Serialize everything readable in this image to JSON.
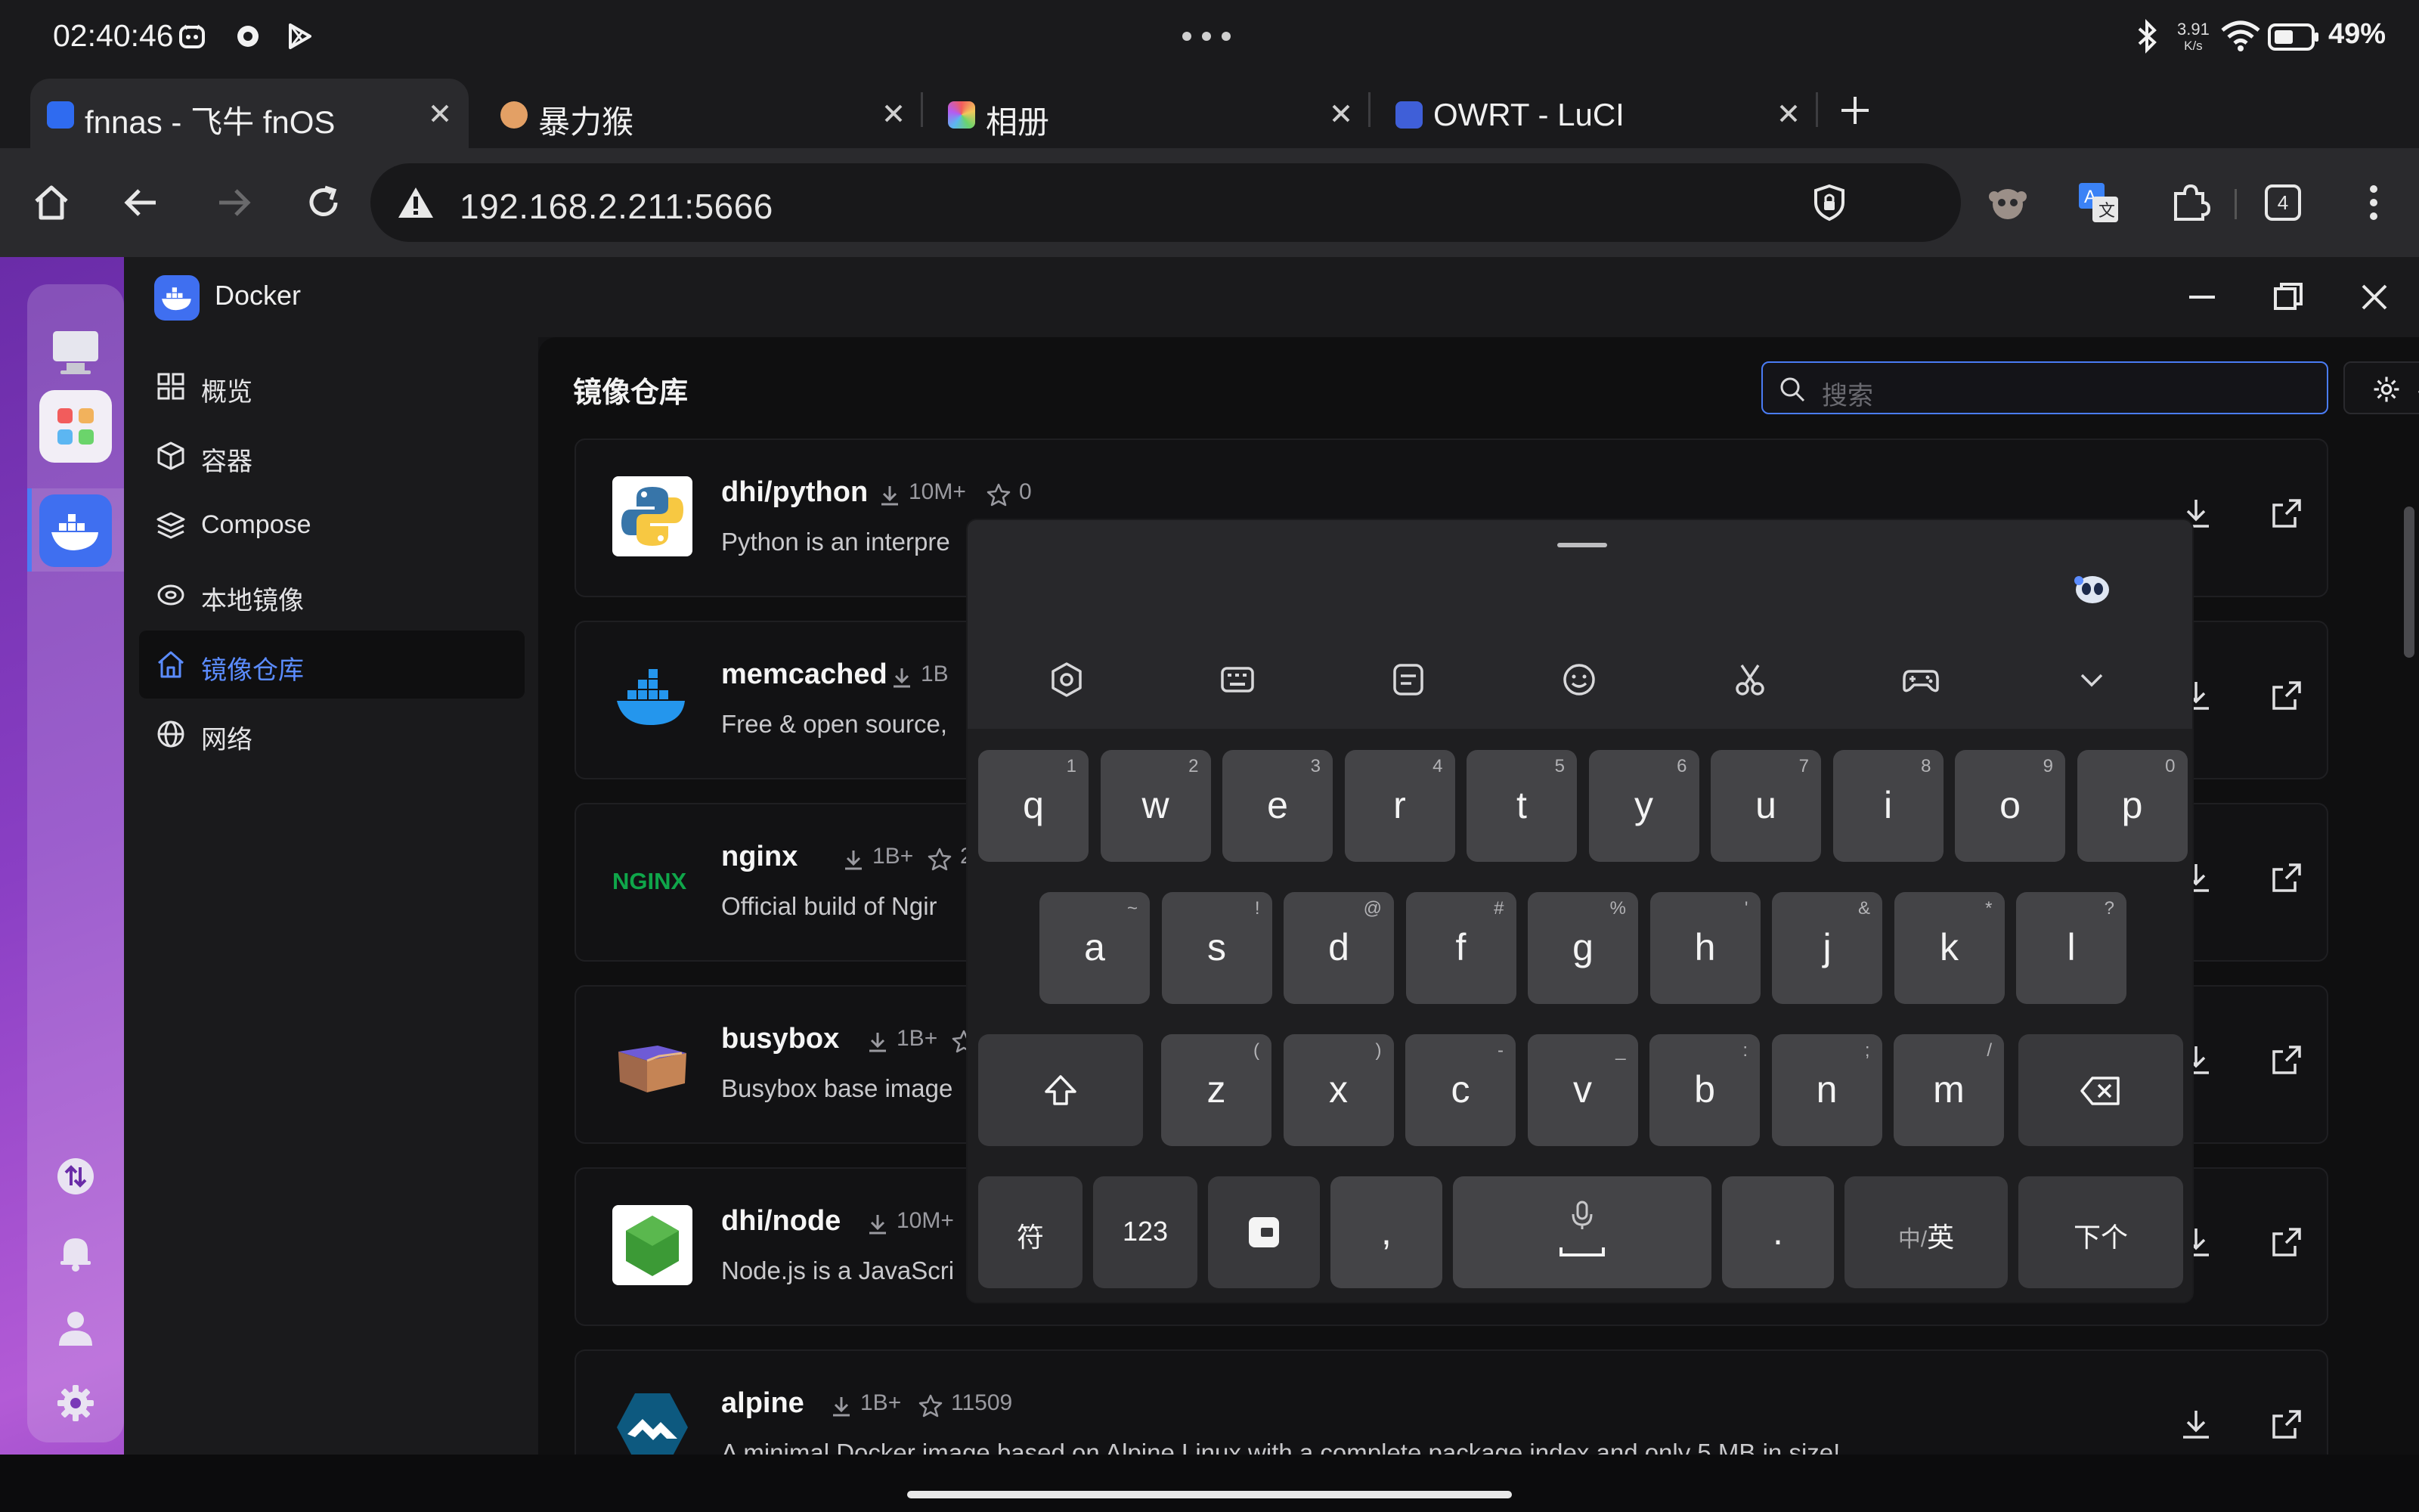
{
  "status_bar": {
    "time": "02:40:46",
    "net_speed_value": "3.91",
    "net_speed_unit": "K/s",
    "battery": "49%"
  },
  "tabs": [
    {
      "title": "fnnas - 飞牛 fnOS",
      "active": true
    },
    {
      "title": "暴力猴",
      "active": false
    },
    {
      "title": "相册",
      "active": false
    },
    {
      "title": "OWRT - LuCI",
      "active": false
    }
  ],
  "toolbar": {
    "url": "192.168.2.211:5666",
    "tab_count": "4"
  },
  "window": {
    "title": "Docker"
  },
  "nav": {
    "items": [
      {
        "label": "概览",
        "icon": "grid-icon"
      },
      {
        "label": "容器",
        "icon": "cube-icon"
      },
      {
        "label": "Compose",
        "icon": "layers-icon"
      },
      {
        "label": "本地镜像",
        "icon": "disc-icon"
      },
      {
        "label": "镜像仓库",
        "icon": "home-icon",
        "active": true
      },
      {
        "label": "网络",
        "icon": "globe-icon"
      }
    ]
  },
  "content": {
    "title": "镜像仓库",
    "search_placeholder": "搜索",
    "settings_label": "设置"
  },
  "repos": [
    {
      "name": "dhi/python",
      "downloads": "10M+",
      "stars": "0",
      "desc": "Python is an interpre"
    },
    {
      "name": "memcached",
      "downloads": "1B",
      "stars": "",
      "desc": "Free & open source,"
    },
    {
      "name": "nginx",
      "downloads": "1B+",
      "stars": "21",
      "desc": "Official build of Ngir"
    },
    {
      "name": "busybox",
      "downloads": "1B+",
      "stars": "",
      "desc": "Busybox base image"
    },
    {
      "name": "dhi/node",
      "downloads": "10M+",
      "stars": "",
      "desc": "Node.js is a JavaScri"
    },
    {
      "name": "alpine",
      "downloads": "1B+",
      "stars": "11509",
      "desc": "A minimal Docker image based on Alpine Linux with a complete package index and only 5 MB in size!"
    }
  ],
  "keyboard": {
    "row1": [
      {
        "k": "q",
        "s": "1"
      },
      {
        "k": "w",
        "s": "2"
      },
      {
        "k": "e",
        "s": "3"
      },
      {
        "k": "r",
        "s": "4"
      },
      {
        "k": "t",
        "s": "5"
      },
      {
        "k": "y",
        "s": "6"
      },
      {
        "k": "u",
        "s": "7"
      },
      {
        "k": "i",
        "s": "8"
      },
      {
        "k": "o",
        "s": "9"
      },
      {
        "k": "p",
        "s": "0"
      }
    ],
    "row2": [
      {
        "k": "a",
        "s": "~"
      },
      {
        "k": "s",
        "s": "!"
      },
      {
        "k": "d",
        "s": "@"
      },
      {
        "k": "f",
        "s": "#"
      },
      {
        "k": "g",
        "s": "%"
      },
      {
        "k": "h",
        "s": "'"
      },
      {
        "k": "j",
        "s": "&"
      },
      {
        "k": "k",
        "s": "*"
      },
      {
        "k": "l",
        "s": "?"
      }
    ],
    "row3": [
      {
        "k": "z",
        "s": "("
      },
      {
        "k": "x",
        "s": ")"
      },
      {
        "k": "c",
        "s": "-"
      },
      {
        "k": "v",
        "s": "_"
      },
      {
        "k": "b",
        "s": ":"
      },
      {
        "k": "n",
        "s": ";"
      },
      {
        "k": "m",
        "s": "/"
      }
    ],
    "symbols_key": "符",
    "numbers_key": "123",
    "comma_key": ",",
    "period_key": ".",
    "lang_key_cn": "中/",
    "lang_key_en": "英",
    "next_key": "下个"
  }
}
